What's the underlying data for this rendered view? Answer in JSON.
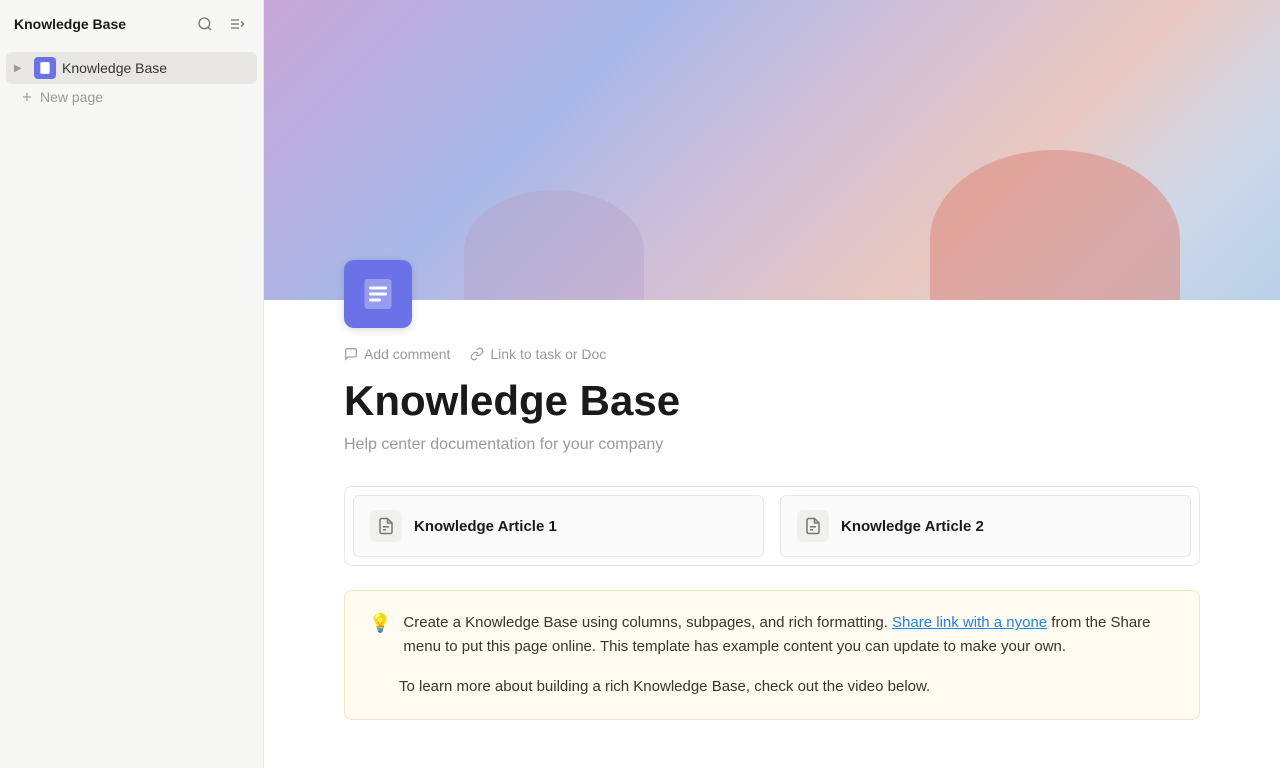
{
  "sidebar": {
    "title": "Knowledge Base",
    "search_label": "Search",
    "collapse_label": "Collapse sidebar",
    "nav_items": [
      {
        "id": "knowledge-base",
        "label": "Knowledge Base",
        "has_children": true,
        "active": true
      }
    ],
    "new_page_label": "New page"
  },
  "main": {
    "action_bar": {
      "comment_label": "Add comment",
      "link_label": "Link to task or Doc"
    },
    "page_title": "Knowledge Base",
    "page_subtitle": "Help center documentation for your company",
    "articles": [
      {
        "id": "article-1",
        "title": "Knowledge Article 1"
      },
      {
        "id": "article-2",
        "title": "Knowledge Article 2"
      }
    ],
    "info_box": {
      "text_1": "Create a Knowledge Base using columns, subpages, and rich formatting.",
      "link_text": "Share link with a nyone",
      "text_2": " from the Share menu to put this page online. This template has example content you can update to make your own.",
      "text_3": "To learn more about building a rich Knowledge Base, check out the video below."
    }
  }
}
